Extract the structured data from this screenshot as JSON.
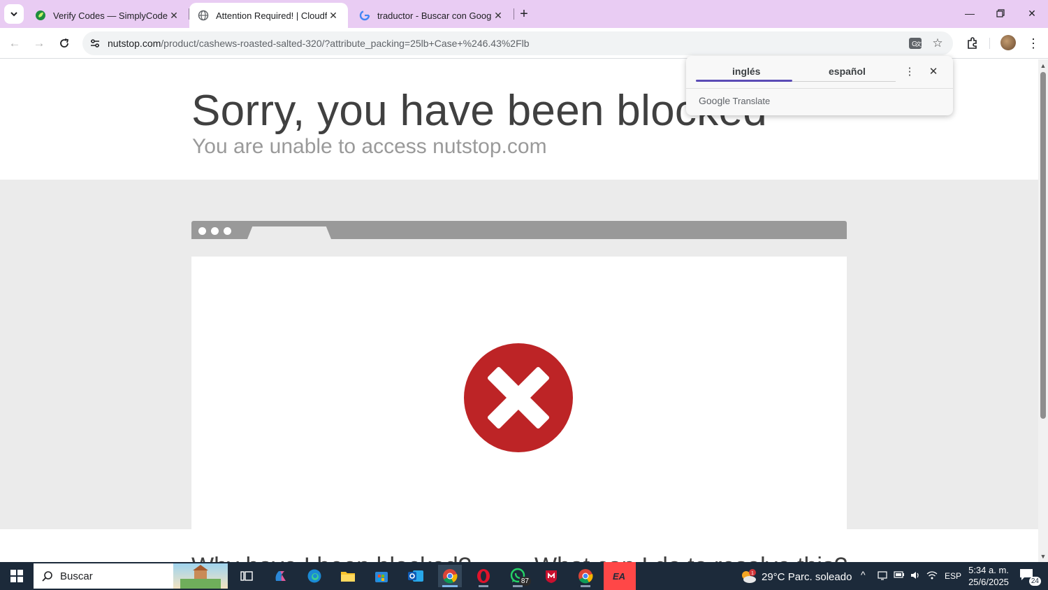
{
  "browser": {
    "tabs": [
      {
        "title": "Verify Codes — SimplyCodes",
        "favicon": "simplycodes-leaf-icon",
        "active": false
      },
      {
        "title": "Attention Required! | Cloudflare",
        "favicon": "globe-icon",
        "active": true
      },
      {
        "title": "traductor - Buscar con Google",
        "favicon": "google-g-icon",
        "active": false
      }
    ],
    "url_host": "nutstop.com",
    "url_path": "/product/cashews-roasted-salted-320/?attribute_packing=25lb+Case+%246.43%2Flb"
  },
  "translate_popup": {
    "source_language": "inglés",
    "target_language": "español",
    "brand_google": "Google",
    "brand_translate": "Translate"
  },
  "page": {
    "title": "Sorry, you have been blocked",
    "subtitle": "You are unable to access nutstop.com",
    "why_heading": "Why have I been blocked?",
    "resolve_heading": "What can I do to resolve this?",
    "colors": {
      "error_red": "#bd2426",
      "grey_band": "#ebebeb",
      "browser_bar": "#999999"
    }
  },
  "taskbar": {
    "search_placeholder": "Buscar",
    "whatsapp_badge": "87",
    "weather": {
      "temp": "29°C",
      "condition": "Parc. soleado",
      "alert_count": "1"
    },
    "language": "ESP",
    "time": "5:34 a. m.",
    "date": "25/6/2025",
    "notification_count": "24"
  }
}
